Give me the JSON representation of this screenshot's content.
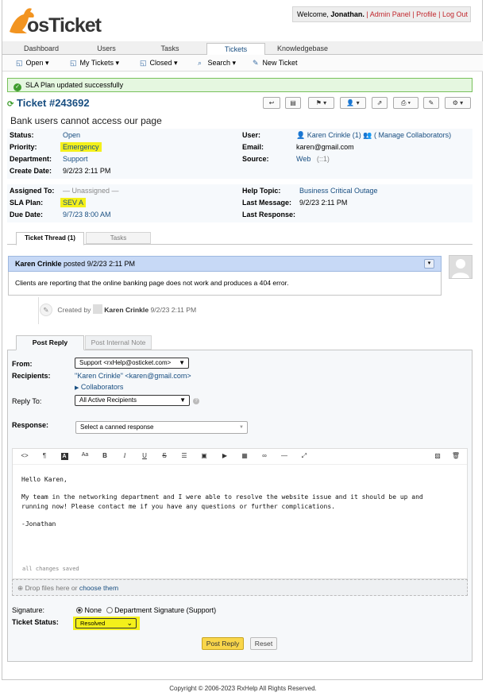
{
  "brand": {
    "logo_text": "osTicket"
  },
  "header": {
    "welcome_prefix": "Welcome, ",
    "user_name": "Jonathan",
    "links": [
      "Admin Panel",
      "Profile",
      "Log Out"
    ]
  },
  "nav": {
    "tabs": [
      "Dashboard",
      "Users",
      "Tasks",
      "Tickets",
      "Knowledgebase"
    ],
    "active_tab": "Tickets",
    "subnav": [
      "Open",
      "My Tickets",
      "Closed",
      "Search",
      "New Ticket"
    ]
  },
  "alert": {
    "message": "SLA Plan updated successfully"
  },
  "ticket": {
    "number": "Ticket #243692",
    "subject": "Bank users cannot access our page",
    "status_label": "Status:",
    "status": "Open",
    "priority_label": "Priority:",
    "priority": "Emergency",
    "department_label": "Department:",
    "department": "Support",
    "create_date_label": "Create Date:",
    "create_date": "9/2/23 2:11 PM",
    "user_label": "User:",
    "user": "Karen Crinkle",
    "user_count": "(1)",
    "manage_collab": "( Manage Collaborators)",
    "email_label": "Email:",
    "email": "karen@gmail.com",
    "source_label": "Source:",
    "source": "Web",
    "source_ip": "(::1)",
    "assigned_label": "Assigned To:",
    "assigned": "— Unassigned —",
    "sla_label": "SLA Plan:",
    "sla": "SEV A",
    "due_label": "Due Date:",
    "due": "9/7/23 8:00 AM",
    "help_topic_label": "Help Topic:",
    "help_topic": "Business Critical Outage",
    "last_message_label": "Last Message:",
    "last_message": "9/2/23 2:11 PM",
    "last_response_label": "Last Response:"
  },
  "thread_tabs": [
    "Ticket Thread (1)",
    "Tasks"
  ],
  "thread": {
    "author": "Karen Crinkle",
    "posted": "posted",
    "time": "9/2/23 2:11 PM",
    "body": "Clients are reporting that the online banking page does not work and produces a 404 error.",
    "created_prefix": "Created by",
    "created_by": "Karen Crinkle",
    "created_time": "9/2/23 2:11 PM"
  },
  "reply": {
    "tabs": [
      "Post Reply",
      "Post Internal Note"
    ],
    "from_label": "From:",
    "from_value": "Support <rxHelp@osticket.com>",
    "recipients_label": "Recipients:",
    "recipients": "\"Karen Crinkle\" <karen@gmail.com>",
    "collaborators": "Collaborators",
    "reply_to_label": "Reply To:",
    "reply_to": "All Active Recipients",
    "response_label": "Response:",
    "response_placeholder": "Select a canned response",
    "body_lines": [
      "Hello Karen,",
      "My team in the networking department and I were able to resolve the website issue and it should be up and running now! Please contact me if you have any questions or further complications.",
      "-Jonathan"
    ],
    "saved_note": "all changes saved",
    "drop_text": "Drop files here or",
    "choose_text": "choose them",
    "signature_label": "Signature:",
    "sig_none": "None",
    "sig_dept": "Department Signature (Support)",
    "status_label": "Ticket Status:",
    "status_value": "Resolved",
    "post_button": "Post Reply",
    "reset_button": "Reset"
  },
  "footer": {
    "copyright": "Copyright © 2006-2023 RxHelp All Rights Reserved."
  },
  "colors": {
    "accent": "#184e81",
    "highlight": "#f4f01a",
    "link_red": "#c1272d",
    "success_bg": "#e5f7e0",
    "post_button": "#f9d64a"
  }
}
